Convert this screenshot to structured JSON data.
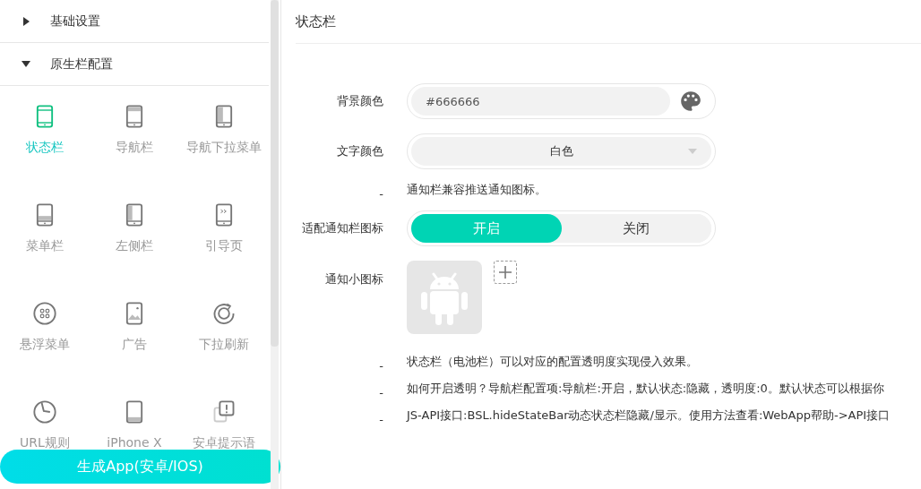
{
  "sidebar": {
    "sections": [
      {
        "label": "基础设置",
        "expanded": false
      },
      {
        "label": "原生栏配置",
        "expanded": true
      }
    ],
    "items": [
      {
        "label": "状态栏",
        "selected": true
      },
      {
        "label": "导航栏",
        "selected": false
      },
      {
        "label": "导航下拉菜单",
        "selected": false
      },
      {
        "label": "菜单栏",
        "selected": false
      },
      {
        "label": "左侧栏",
        "selected": false
      },
      {
        "label": "引导页",
        "selected": false
      },
      {
        "label": "悬浮菜单",
        "selected": false
      },
      {
        "label": "广告",
        "selected": false
      },
      {
        "label": "下拉刷新",
        "selected": false
      },
      {
        "label": "URL规则",
        "selected": false
      },
      {
        "label": "iPhone X",
        "selected": false
      },
      {
        "label": "安卓提示语",
        "selected": false
      }
    ],
    "generate_button": "生成App(安卓/IOS)"
  },
  "main": {
    "title": "状态栏",
    "background_color": {
      "label": "背景颜色",
      "value": "#666666"
    },
    "text_color": {
      "label": "文字颜色",
      "value": "白色"
    },
    "notify_hint": {
      "marker": "-",
      "text": "通知栏兼容推送通知图标。"
    },
    "notify_adapt": {
      "label": "适配通知栏图标",
      "options": [
        {
          "label": "开启",
          "selected": true
        },
        {
          "label": "关闭",
          "selected": false
        }
      ]
    },
    "notify_icon": {
      "label": "通知小图标"
    },
    "notes": [
      {
        "marker": "-",
        "text": "状态栏（电池栏）可以对应的配置透明度实现侵入效果。"
      },
      {
        "marker": "-",
        "text": "如何开启透明？导航栏配置项:导航栏:开启，默认状态:隐藏，透明度:0。默认状态可以根据你"
      },
      {
        "marker": "-",
        "text": "JS-API接口:BSL.hideStateBar动态状态栏隐藏/显示。使用方法查看:WebApp帮助->API接口"
      }
    ]
  }
}
